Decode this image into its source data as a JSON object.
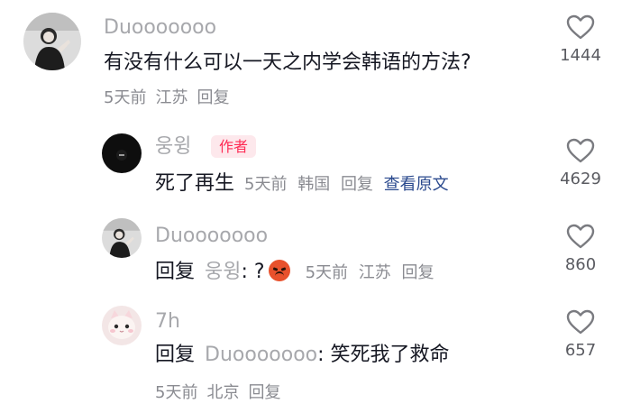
{
  "comment1": {
    "username": "Duooooooo",
    "text": "有没有什么可以一天之内学会韩语的方法?",
    "time": "5天前",
    "location": "江苏",
    "reply_label": "回复",
    "likes": "1444"
  },
  "reply1": {
    "username": "웅윙",
    "author_badge": "作者",
    "text": "死了再生",
    "time": "5天前",
    "location": "韩国",
    "reply_label": "回复",
    "translate_label": "查看原文",
    "likes": "4629"
  },
  "reply2": {
    "username": "Duooooooo",
    "reply_prefix": "回复",
    "target_user": "웅윙",
    "colon_text": ": ?",
    "time": "5天前",
    "location": "江苏",
    "reply_label": "回复",
    "likes": "860"
  },
  "reply3": {
    "username": "7h",
    "reply_prefix": "回复",
    "target_user": "Duooooooo",
    "text": ": 笑死我了救命",
    "time": "5天前",
    "location": "北京",
    "reply_label": "回复",
    "likes": "657"
  },
  "icons": {
    "like": "heart-outline-icon",
    "angry_emoji": "angry-face-emoji"
  },
  "colors": {
    "author_badge_text": "#fe2c55",
    "author_badge_bg": "#fde8ec",
    "link": "#2b4a8e",
    "username": "#a7a8ac"
  }
}
